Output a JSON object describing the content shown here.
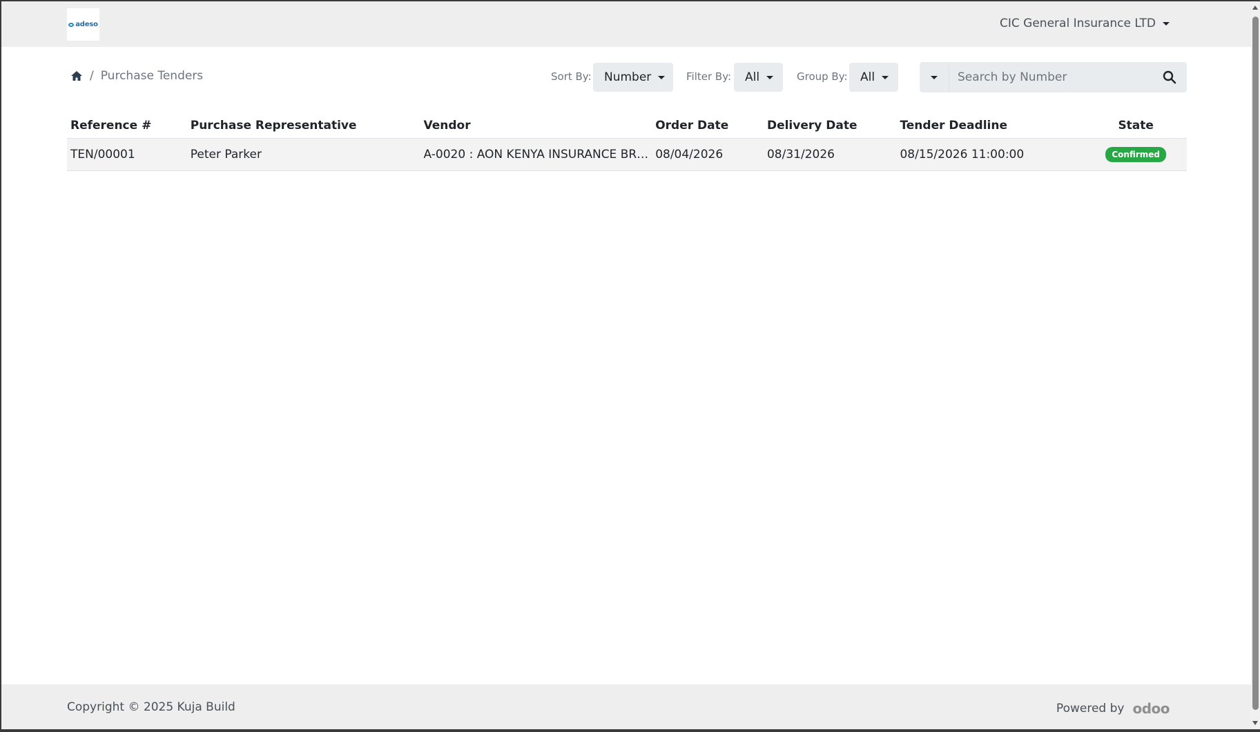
{
  "header": {
    "logo_text": "adeso",
    "company_name": "CIC General Insurance LTD"
  },
  "breadcrumb": {
    "current": "Purchase Tenders",
    "separator": "/"
  },
  "toolbar": {
    "sort_label": "Sort By:",
    "sort_value": "Number",
    "filter_label": "Filter By:",
    "filter_value": "All",
    "group_label": "Group By:",
    "group_value": "All",
    "search_placeholder": "Search by Number"
  },
  "table": {
    "columns": [
      "Reference #",
      "Purchase Representative",
      "Vendor",
      "Order Date",
      "Delivery Date",
      "Tender Deadline",
      "State"
    ],
    "rows": [
      {
        "reference": "TEN/00001",
        "representative": "Peter Parker",
        "vendor": "A-0020 : AON KENYA INSURANCE BR…",
        "order_date": "08/04/2026",
        "delivery_date": "08/31/2026",
        "tender_deadline": "08/15/2026 11:00:00",
        "state": "Confirmed"
      }
    ]
  },
  "footer": {
    "copyright": "Copyright © 2025 Kuja Build",
    "powered_by": "Powered by",
    "powered_brand": "odoo"
  },
  "colors": {
    "badge_confirmed": "#28a745",
    "navbar_bg": "#eeeeee",
    "logo_blue": "#1f6fa8"
  }
}
